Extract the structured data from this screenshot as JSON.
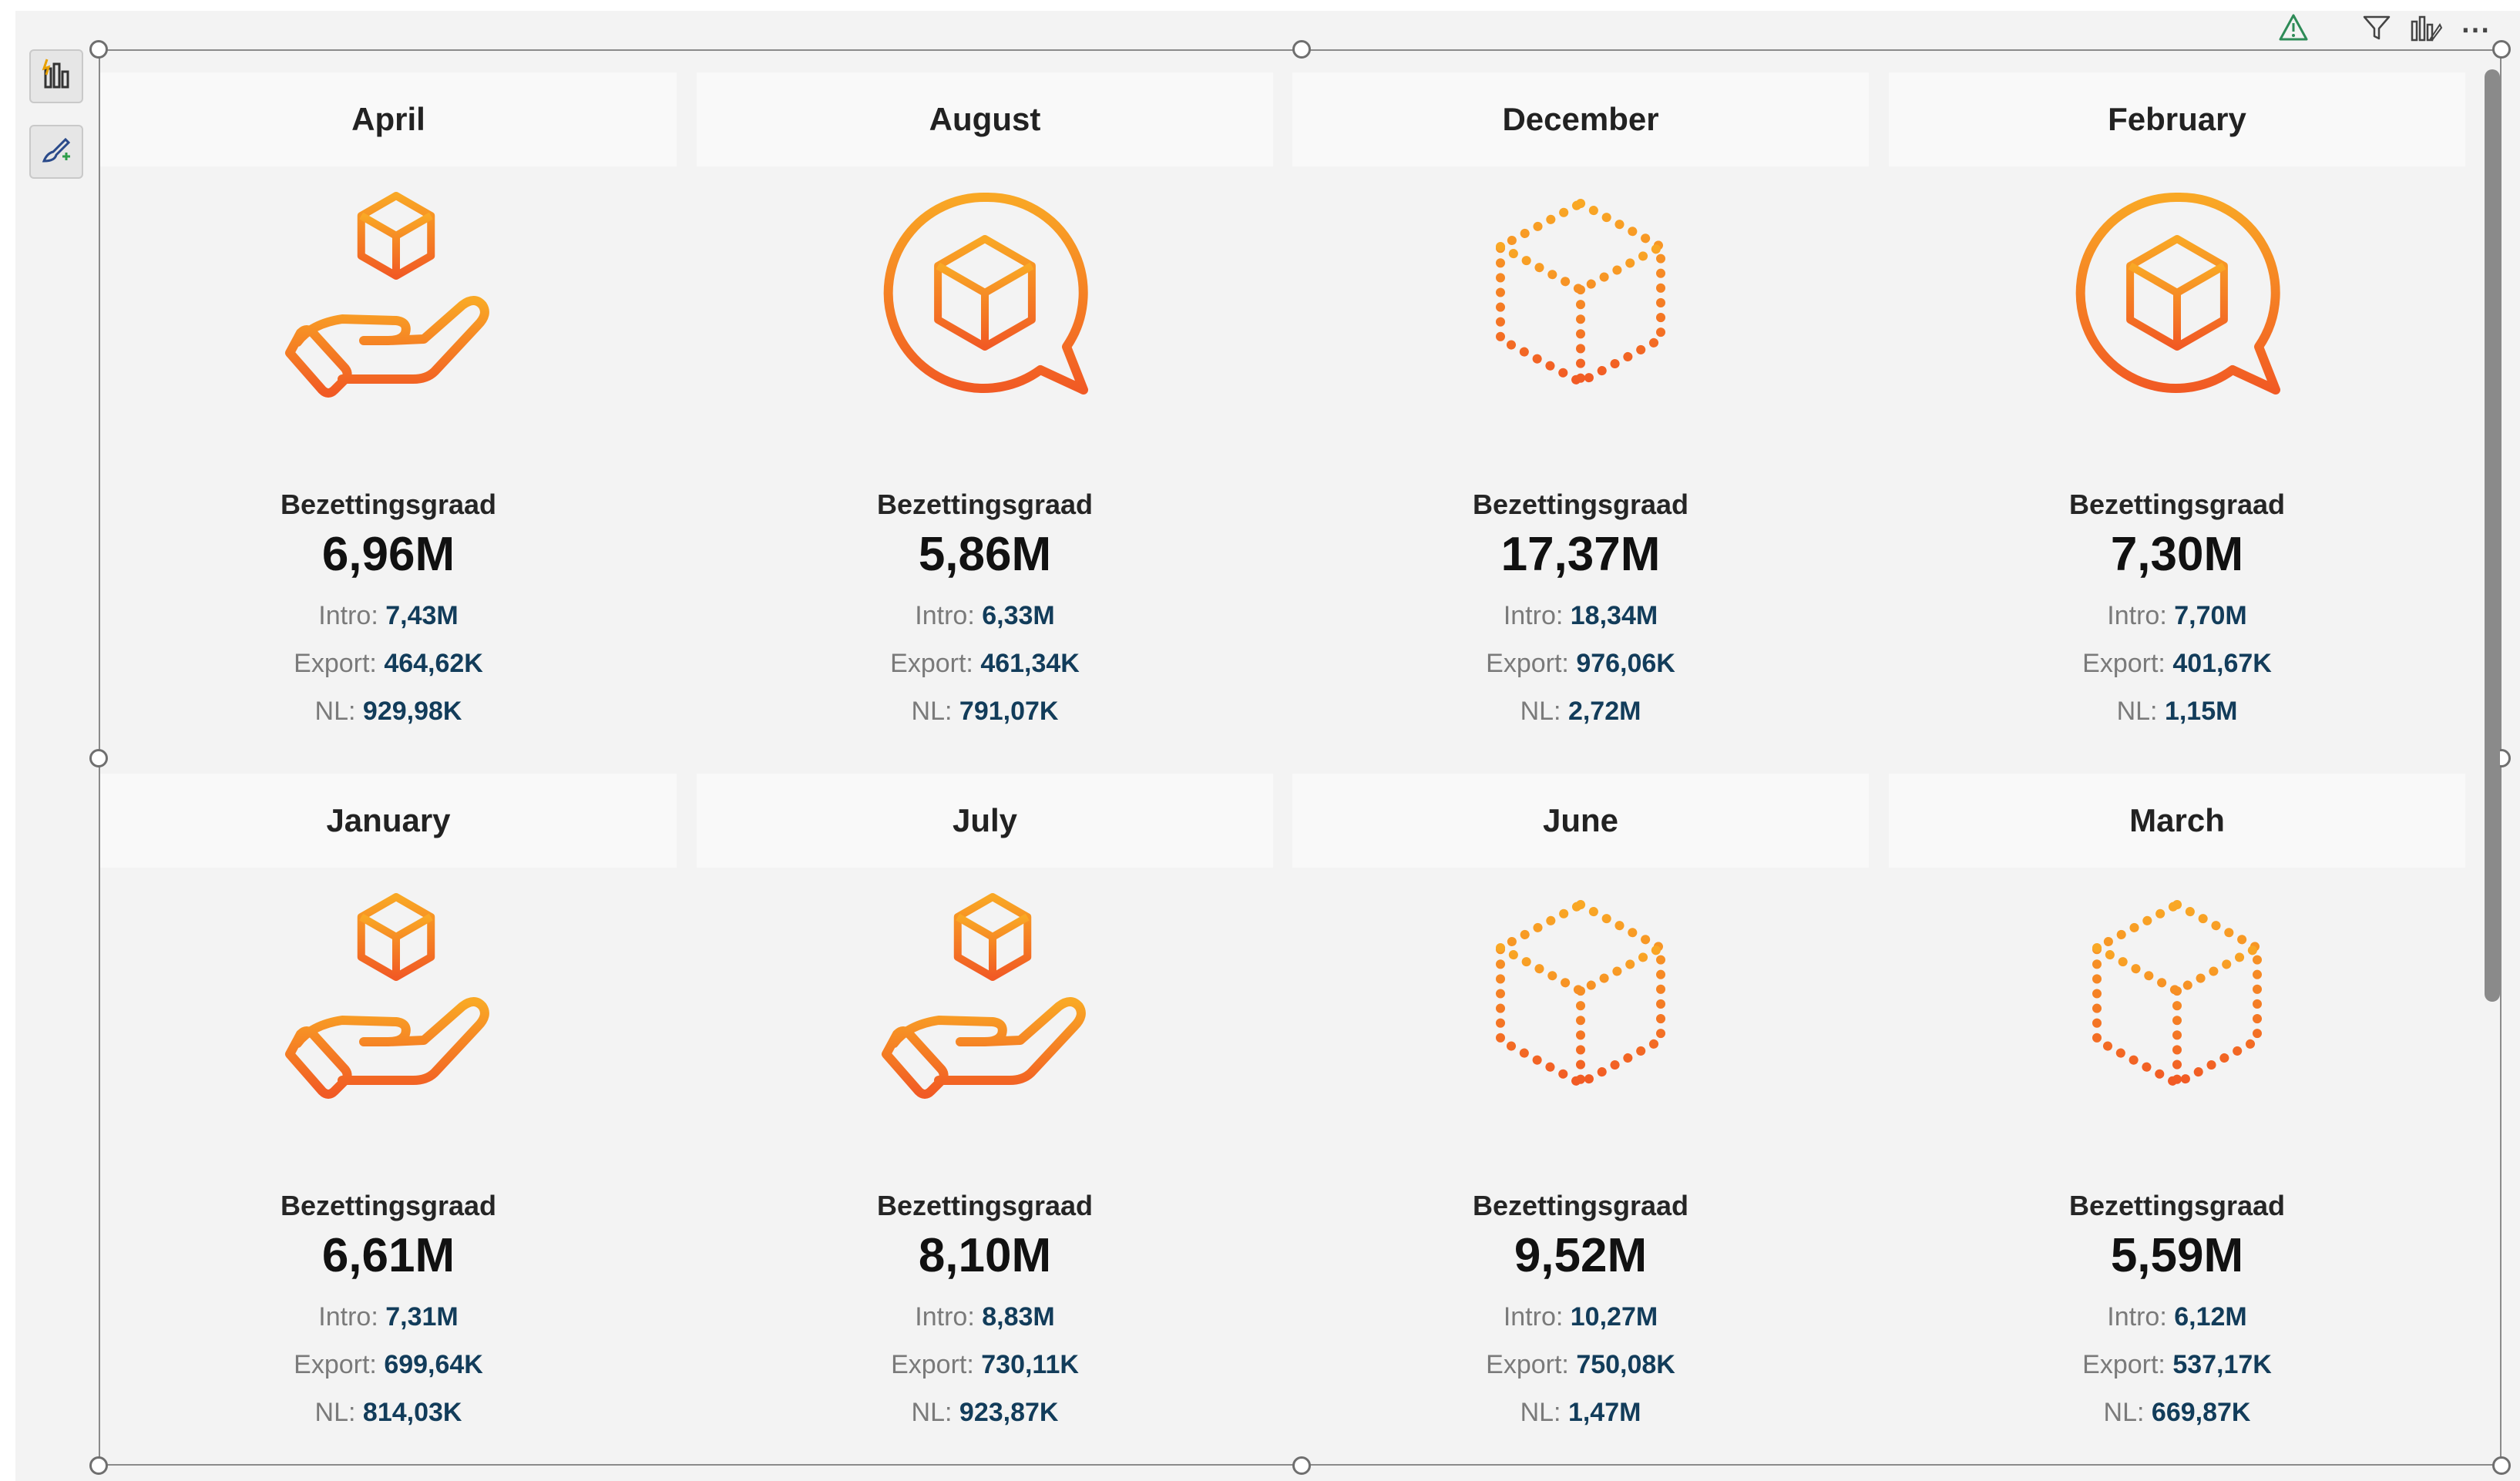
{
  "header": {
    "icons": [
      "warning-icon",
      "filter-icon",
      "visual-icon",
      "more-options-icon"
    ],
    "more_label": "⋯"
  },
  "toolbar": {
    "icons": [
      "build-visual-icon",
      "format-visual-icon"
    ]
  },
  "colors": {
    "accent_orange": "#f7941d",
    "accent_red_orange": "#f15a24",
    "value_blue": "#123c5a",
    "warning_green": "#2e8b57"
  },
  "cards": [
    {
      "title": "April",
      "icon": "hand-box-icon",
      "label": "Bezettingsgraad",
      "value": "6,96M",
      "intro_label": "Intro:",
      "intro": "7,43M",
      "export_label": "Export:",
      "export": "464,62K",
      "nl_label": "NL:",
      "nl": "929,98K"
    },
    {
      "title": "August",
      "icon": "chat-box-icon",
      "label": "Bezettingsgraad",
      "value": "5,86M",
      "intro_label": "Intro:",
      "intro": "6,33M",
      "export_label": "Export:",
      "export": "461,34K",
      "nl_label": "NL:",
      "nl": "791,07K"
    },
    {
      "title": "December",
      "icon": "dotted-cube-icon",
      "label": "Bezettingsgraad",
      "value": "17,37M",
      "intro_label": "Intro:",
      "intro": "18,34M",
      "export_label": "Export:",
      "export": "976,06K",
      "nl_label": "NL:",
      "nl": "2,72M"
    },
    {
      "title": "February",
      "icon": "chat-box-icon",
      "label": "Bezettingsgraad",
      "value": "7,30M",
      "intro_label": "Intro:",
      "intro": "7,70M",
      "export_label": "Export:",
      "export": "401,67K",
      "nl_label": "NL:",
      "nl": "1,15M"
    },
    {
      "title": "January",
      "icon": "hand-box-icon",
      "label": "Bezettingsgraad",
      "value": "6,61M",
      "intro_label": "Intro:",
      "intro": "7,31M",
      "export_label": "Export:",
      "export": "699,64K",
      "nl_label": "NL:",
      "nl": "814,03K"
    },
    {
      "title": "July",
      "icon": "hand-box-icon",
      "label": "Bezettingsgraad",
      "value": "8,10M",
      "intro_label": "Intro:",
      "intro": "8,83M",
      "export_label": "Export:",
      "export": "730,11K",
      "nl_label": "NL:",
      "nl": "923,87K"
    },
    {
      "title": "June",
      "icon": "dotted-cube-icon",
      "label": "Bezettingsgraad",
      "value": "9,52M",
      "intro_label": "Intro:",
      "intro": "10,27M",
      "export_label": "Export:",
      "export": "750,08K",
      "nl_label": "NL:",
      "nl": "1,47M"
    },
    {
      "title": "March",
      "icon": "dotted-cube-icon",
      "label": "Bezettingsgraad",
      "value": "5,59M",
      "intro_label": "Intro:",
      "intro": "6,12M",
      "export_label": "Export:",
      "export": "537,17K",
      "nl_label": "NL:",
      "nl": "669,87K"
    }
  ]
}
